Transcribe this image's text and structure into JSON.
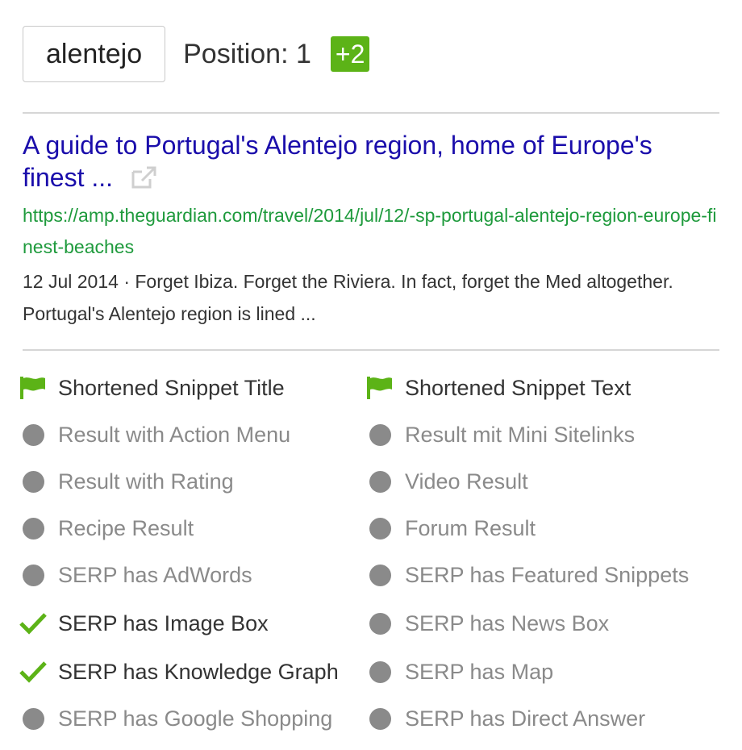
{
  "header": {
    "keyword": "alentejo",
    "position_text": "Position: 1",
    "delta": "+2"
  },
  "result": {
    "title": "A guide to Portugal's Alentejo region, home of Europe's finest ...",
    "url": "https://amp.theguardian.com/travel/2014/jul/12/-sp-portugal-alentejo-region-europe-finest-beaches",
    "snippet": "12 Jul 2014 · Forget Ibiza. Forget the Riviera. In fact, forget the Med altogether. Portugal's Alentejo region is lined ..."
  },
  "colors": {
    "title_link": "#1a0dab",
    "url_green": "#1e9a3c",
    "accent_green": "#5cb317",
    "inactive_gray": "#8a8a8a"
  },
  "features": [
    {
      "label": "Shortened Snippet Title",
      "state": "flag",
      "icon": "flag-icon"
    },
    {
      "label": "Shortened Snippet Text",
      "state": "flag",
      "icon": "flag-icon"
    },
    {
      "label": "Result with Action Menu",
      "state": "off",
      "icon": "dot-icon"
    },
    {
      "label": "Result mit Mini Sitelinks",
      "state": "off",
      "icon": "dot-icon"
    },
    {
      "label": "Result with Rating",
      "state": "off",
      "icon": "dot-icon"
    },
    {
      "label": "Video Result",
      "state": "off",
      "icon": "dot-icon"
    },
    {
      "label": "Recipe Result",
      "state": "off",
      "icon": "dot-icon"
    },
    {
      "label": "Forum Result",
      "state": "off",
      "icon": "dot-icon"
    },
    {
      "label": "SERP has AdWords",
      "state": "off",
      "icon": "dot-icon"
    },
    {
      "label": "SERP has Featured Snippets",
      "state": "off",
      "icon": "dot-icon"
    },
    {
      "label": "SERP has Image Box",
      "state": "check",
      "icon": "check-icon"
    },
    {
      "label": "SERP has News Box",
      "state": "off",
      "icon": "dot-icon"
    },
    {
      "label": "SERP has Knowledge Graph",
      "state": "check",
      "icon": "check-icon"
    },
    {
      "label": "SERP has Map",
      "state": "off",
      "icon": "dot-icon"
    },
    {
      "label": "SERP has Google Shopping",
      "state": "off",
      "icon": "dot-icon"
    },
    {
      "label": "SERP has Direct Answer",
      "state": "off",
      "icon": "dot-icon"
    }
  ]
}
